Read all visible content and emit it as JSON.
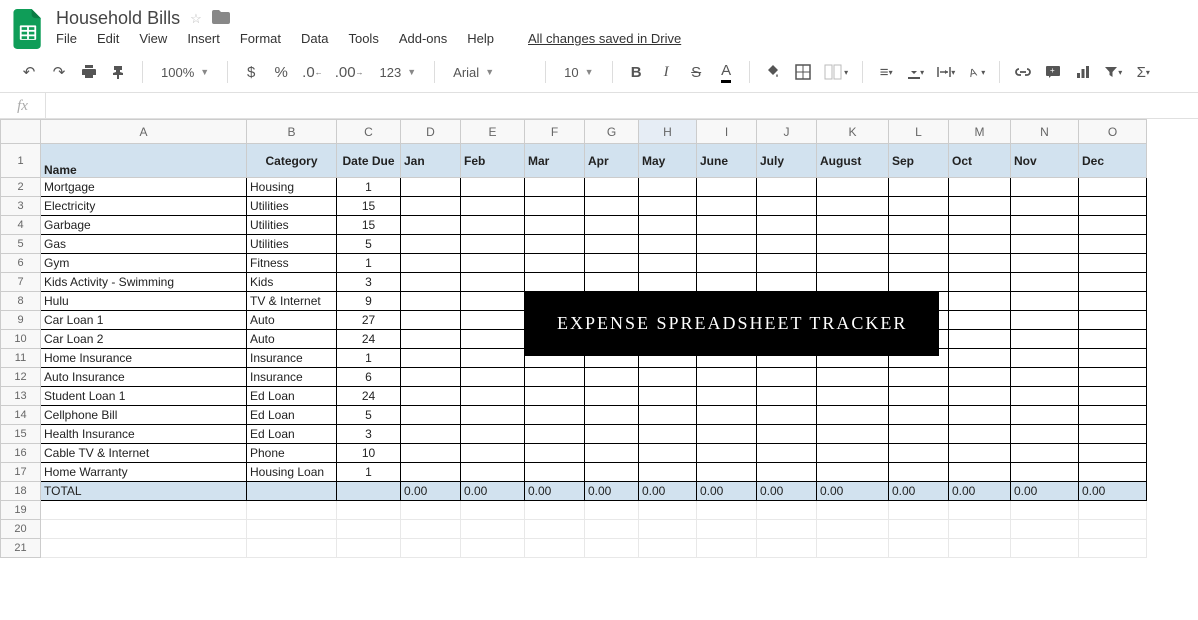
{
  "doc": {
    "title": "Household Bills",
    "savedMsg": "All changes saved in Drive"
  },
  "menus": [
    "File",
    "Edit",
    "View",
    "Insert",
    "Format",
    "Data",
    "Tools",
    "Add-ons",
    "Help"
  ],
  "toolbar": {
    "zoom": "100%",
    "moreFormats": "123",
    "font": "Arial",
    "fontSize": "10"
  },
  "fx": {
    "label": "fx"
  },
  "overlay": "EXPENSE SPREADSHEET TRACKER",
  "columns": [
    "A",
    "B",
    "C",
    "D",
    "E",
    "F",
    "G",
    "H",
    "I",
    "J",
    "K",
    "L",
    "M",
    "N",
    "O"
  ],
  "activeCol": "H",
  "headers": {
    "name": "Name",
    "category": "Category",
    "dateDue": "Date Due",
    "months": [
      "Jan",
      "Feb",
      "Mar",
      "Apr",
      "May",
      "June",
      "July",
      "August",
      "Sep",
      "Oct",
      "Nov",
      "Dec"
    ]
  },
  "rows": [
    {
      "name": "Mortgage",
      "category": "Housing",
      "due": "1"
    },
    {
      "name": "Electricity",
      "category": "Utilities",
      "due": "15"
    },
    {
      "name": "Garbage",
      "category": "Utilities",
      "due": "15"
    },
    {
      "name": "Gas",
      "category": "Utilities",
      "due": "5"
    },
    {
      "name": "Gym",
      "category": "Fitness",
      "due": "1"
    },
    {
      "name": "Kids Activity - Swimming",
      "category": "Kids",
      "due": "3"
    },
    {
      "name": "Hulu",
      "category": "TV & Internet",
      "due": "9"
    },
    {
      "name": "Car Loan 1",
      "category": "Auto",
      "due": "27"
    },
    {
      "name": "Car Loan 2",
      "category": "Auto",
      "due": "24"
    },
    {
      "name": "Home Insurance",
      "category": "Insurance",
      "due": "1"
    },
    {
      "name": "Auto Insurance",
      "category": "Insurance",
      "due": "6"
    },
    {
      "name": "Student Loan 1",
      "category": "Ed Loan",
      "due": "24"
    },
    {
      "name": "Cellphone Bill",
      "category": "Ed Loan",
      "due": "5"
    },
    {
      "name": "Health Insurance",
      "category": "Ed Loan",
      "due": "3"
    },
    {
      "name": "Cable TV & Internet",
      "category": "Phone",
      "due": "10"
    },
    {
      "name": "Home Warranty",
      "category": "Housing Loan",
      "due": "1"
    }
  ],
  "total": {
    "label": "TOTAL",
    "values": [
      "0.00",
      "0.00",
      "0.00",
      "0.00",
      "0.00",
      "0.00",
      "0.00",
      "0.00",
      "0.00",
      "0.00",
      "0.00",
      "0.00"
    ]
  }
}
